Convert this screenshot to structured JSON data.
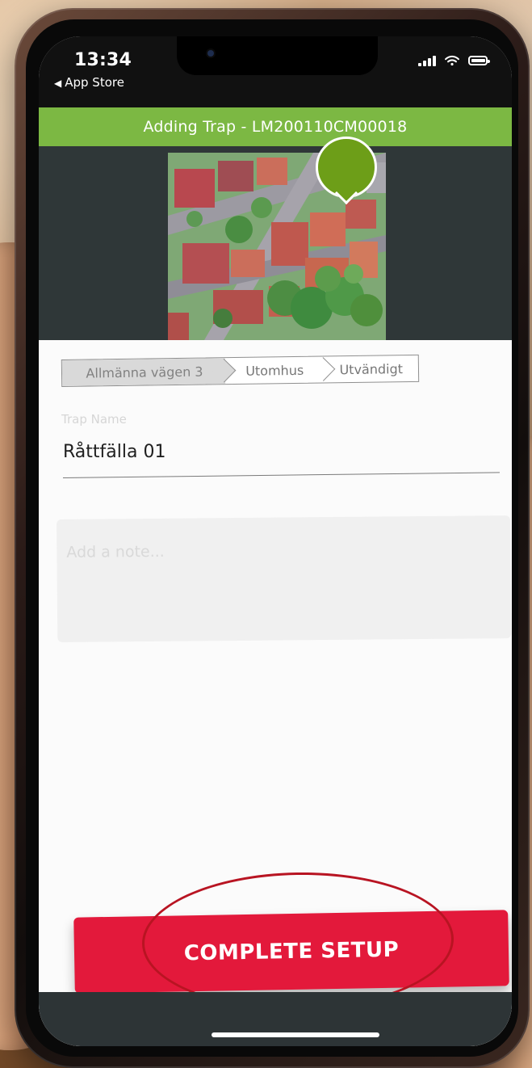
{
  "status_bar": {
    "time": "13:34",
    "back_label": "App Store",
    "back_icon": "chevron-left-icon",
    "signal_icon": "signal-icon",
    "wifi_icon": "wifi-icon",
    "battery_icon": "battery-icon"
  },
  "header": {
    "title": "Adding Trap - LM200110CM00018",
    "background_color": "#7cb843"
  },
  "map": {
    "pin_icon": "map-pin-icon",
    "pin_color": "#6d9e18"
  },
  "breadcrumb": {
    "items": [
      {
        "label": "Allmänna vägen 3"
      },
      {
        "label": "Utomhus"
      },
      {
        "label": "Utvändigt"
      }
    ]
  },
  "form": {
    "trap_name_label": "Trap Name",
    "trap_name_value": "Råttfälla 01",
    "note_placeholder": "Add a note..."
  },
  "actions": {
    "complete_button_label": "COMPLETE SETUP",
    "button_color": "#e3193b"
  }
}
